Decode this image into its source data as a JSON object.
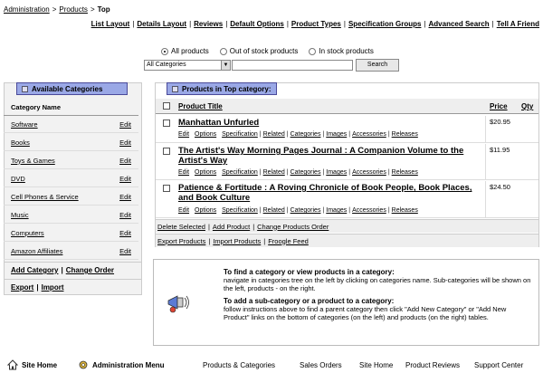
{
  "breadcrumb": {
    "items": [
      "Administration",
      "Products",
      "Top"
    ]
  },
  "toplinks": [
    "List Layout",
    "Details Layout",
    "Reviews",
    "Default Options",
    "Product Types",
    "Specification Groups",
    "Advanced Search",
    "Tell A Friend"
  ],
  "filters": {
    "options": [
      "All products",
      "Out of stock products",
      "In stock products"
    ],
    "selected": 0
  },
  "search": {
    "category_value": "All Categories",
    "button_label": "Search"
  },
  "left_panel": {
    "title": "Available Categories",
    "column_header": "Category Name",
    "edit_label": "Edit",
    "categories": [
      "Software",
      "Books",
      "Toys & Games",
      "DVD",
      "Cell Phones & Service",
      "Music",
      "Computers",
      "Amazon Affiliates"
    ],
    "footer_links_1": [
      "Add Category",
      "Change Order"
    ],
    "footer_links_2": [
      "Export",
      "Import"
    ]
  },
  "right_panel": {
    "title": "Products in Top category:",
    "col_title": "Product Title",
    "col_price": "Price",
    "col_qty": "Qty",
    "actions": [
      "Edit",
      "Options",
      "Specification",
      "Related",
      "Categories",
      "Images",
      "Accessories",
      "Releases"
    ],
    "products": [
      {
        "title": "Manhattan Unfurled",
        "price": "$20.95"
      },
      {
        "title": "The Artist's Way Morning Pages Journal : A Companion Volume to the Artist's Way",
        "price": "$11.95"
      },
      {
        "title": "Patience & Fortitude : A Roving Chronicle of Book People, Book Places, and Book Culture",
        "price": "$24.50"
      }
    ],
    "bottom_links_1": [
      "Delete Selected",
      "Add Product",
      "Change Products Order"
    ],
    "bottom_links_2": [
      "Export Products",
      "Import Products",
      "Froogle Feed"
    ]
  },
  "info": {
    "h1": "To find a category or view products in a category:",
    "p1": "navigate in categories tree on the left by clicking on categories name. Sub-categories will be shown on the left, products - on the right.",
    "h2": "To add a sub-category or a product to a category:",
    "p2": "follow instructions above to find a parent category then click \"Add New Category\" or \"Add New Product\" links on the bottom of categories (on the left) and products (on the right) tables."
  },
  "footer": {
    "site_home": "Site Home",
    "admin_menu": "Administration Menu",
    "links": [
      "Products & Categories",
      "Sales Orders",
      "Site Home",
      "Product Reviews",
      "Support Center"
    ]
  }
}
